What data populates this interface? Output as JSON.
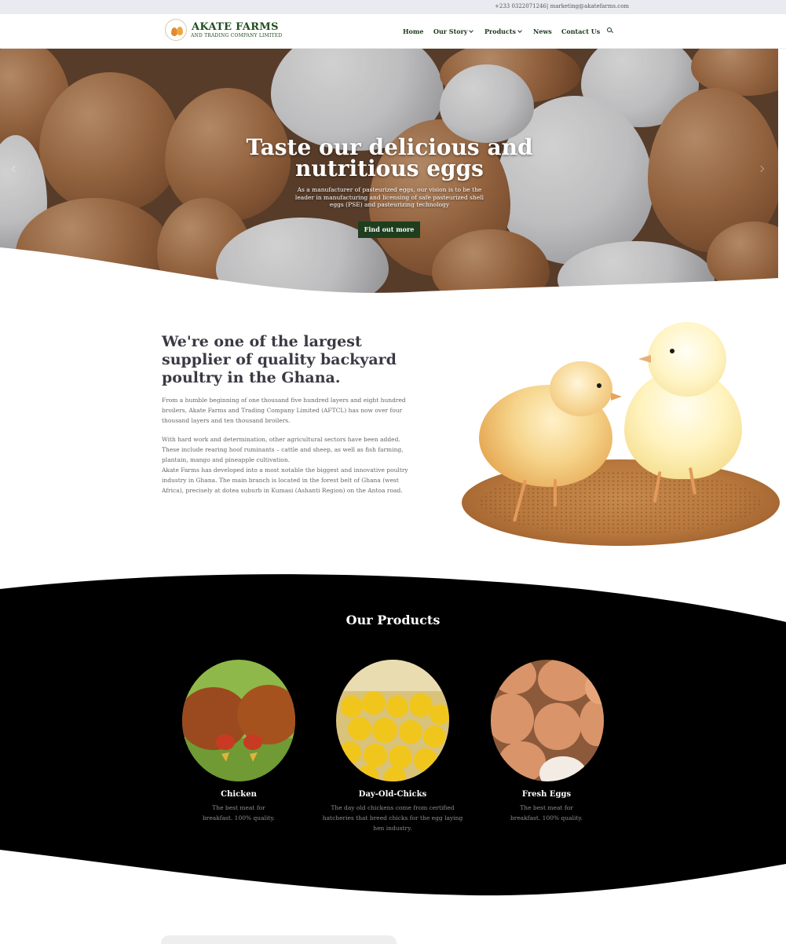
{
  "topbar": {
    "phone": "+233 0322071246",
    "email": "| marketing@akatefarms.com"
  },
  "brand": {
    "name": "AKATE FARMS",
    "subtitle": "AND TRADING COMPANY LIMITED",
    "logo_icon": "egg-basket-logo"
  },
  "nav": {
    "items": [
      {
        "label": "Home",
        "dropdown": false
      },
      {
        "label": "Our Story",
        "dropdown": true
      },
      {
        "label": "Products",
        "dropdown": true
      },
      {
        "label": "News",
        "dropdown": false
      },
      {
        "label": "Contact Us",
        "dropdown": false
      }
    ],
    "search_icon": "search-icon"
  },
  "hero": {
    "title": "Taste our delicious and nutritious eggs",
    "text": "As a manufacturer of pasteurized eggs, our vision is to be the leader in manufacturing and licensing of safe pasteurized shell eggs (PSE) and pasteurizing technology",
    "button": "Find out more"
  },
  "about": {
    "title": "We're one of the largest supplier of quality backyard poultry in the Ghana.",
    "paragraphs": [
      "From a humble beginning of one thousand five hundred layers and eight hundred broilers, Akate Farms and Trading Company Limited (AFTCL) has now over four thousand layers and ten thousand broilers.",
      "With hard work and determination, other agricultural sectors have been added. These include rearing hoof ruminants – cattle and sheep, as well as fish farming, plantain, mango and pineapple cultivation.",
      "Akate Farms has developed into a most notable the biggest and innovative poultry industry in Ghana. The main branch is located in the forest belt of Ghana (west Africa), precisely at dotea suburb in Kumasi (Ashanti Region) on the Antoa road."
    ]
  },
  "products": {
    "title": "Our Products",
    "items": [
      {
        "name": "Chicken",
        "description": "The best meat for breakfast. 100% quality."
      },
      {
        "name": "Day-Old-Chicks",
        "description": "The day old chickens come from certified hatcheries that breed chicks for the egg laying hen industry."
      },
      {
        "name": "Fresh Eggs",
        "description": "The best meat for breakfast. 100% quality."
      }
    ]
  },
  "colors": {
    "brand_green": "#1f4d1f",
    "button_green": "#1e3e1e",
    "topbar_bg": "#e8ebf0",
    "products_bg": "#000000"
  }
}
